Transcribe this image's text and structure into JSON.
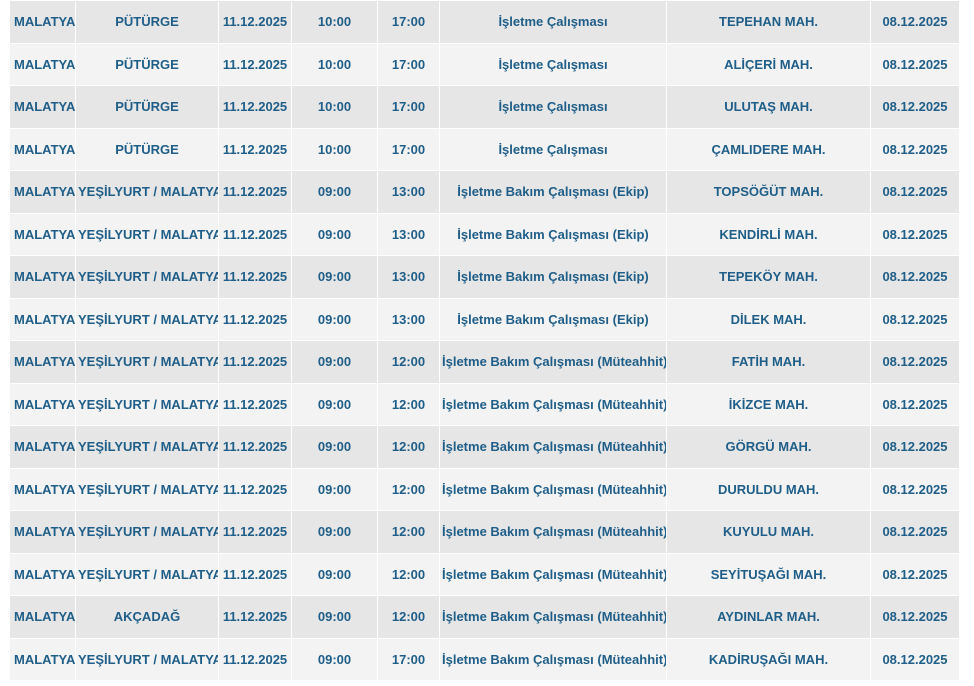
{
  "rows": [
    {
      "province": "MALATYA",
      "district": "PÜTÜRGE",
      "date": "11.12.2025",
      "start": "10:00",
      "end": "17:00",
      "type": "İşletme Çalışması",
      "neighborhood": "TEPEHAN MAH.",
      "announced": "08.12.2025"
    },
    {
      "province": "MALATYA",
      "district": "PÜTÜRGE",
      "date": "11.12.2025",
      "start": "10:00",
      "end": "17:00",
      "type": "İşletme Çalışması",
      "neighborhood": "ALİÇERİ MAH.",
      "announced": "08.12.2025"
    },
    {
      "province": "MALATYA",
      "district": "PÜTÜRGE",
      "date": "11.12.2025",
      "start": "10:00",
      "end": "17:00",
      "type": "İşletme Çalışması",
      "neighborhood": "ULUTAŞ MAH.",
      "announced": "08.12.2025"
    },
    {
      "province": "MALATYA",
      "district": "PÜTÜRGE",
      "date": "11.12.2025",
      "start": "10:00",
      "end": "17:00",
      "type": "İşletme Çalışması",
      "neighborhood": "ÇAMLIDERE MAH.",
      "announced": "08.12.2025"
    },
    {
      "province": "MALATYA",
      "district": "YEŞİLYURT / MALATYA",
      "date": "11.12.2025",
      "start": "09:00",
      "end": "13:00",
      "type": "İşletme Bakım Çalışması (Ekip)",
      "neighborhood": "TOPSÖĞÜT MAH.",
      "announced": "08.12.2025"
    },
    {
      "province": "MALATYA",
      "district": "YEŞİLYURT / MALATYA",
      "date": "11.12.2025",
      "start": "09:00",
      "end": "13:00",
      "type": "İşletme Bakım Çalışması (Ekip)",
      "neighborhood": "KENDİRLİ MAH.",
      "announced": "08.12.2025"
    },
    {
      "province": "MALATYA",
      "district": "YEŞİLYURT / MALATYA",
      "date": "11.12.2025",
      "start": "09:00",
      "end": "13:00",
      "type": "İşletme Bakım Çalışması (Ekip)",
      "neighborhood": "TEPEKÖY MAH.",
      "announced": "08.12.2025"
    },
    {
      "province": "MALATYA",
      "district": "YEŞİLYURT / MALATYA",
      "date": "11.12.2025",
      "start": "09:00",
      "end": "13:00",
      "type": "İşletme Bakım Çalışması (Ekip)",
      "neighborhood": "DİLEK MAH.",
      "announced": "08.12.2025"
    },
    {
      "province": "MALATYA",
      "district": "YEŞİLYURT / MALATYA",
      "date": "11.12.2025",
      "start": "09:00",
      "end": "12:00",
      "type": "İşletme Bakım Çalışması (Müteahhit)",
      "neighborhood": "FATİH MAH.",
      "announced": "08.12.2025"
    },
    {
      "province": "MALATYA",
      "district": "YEŞİLYURT / MALATYA",
      "date": "11.12.2025",
      "start": "09:00",
      "end": "12:00",
      "type": "İşletme Bakım Çalışması (Müteahhit)",
      "neighborhood": "İKİZCE MAH.",
      "announced": "08.12.2025"
    },
    {
      "province": "MALATYA",
      "district": "YEŞİLYURT / MALATYA",
      "date": "11.12.2025",
      "start": "09:00",
      "end": "12:00",
      "type": "İşletme Bakım Çalışması (Müteahhit)",
      "neighborhood": "GÖRGÜ MAH.",
      "announced": "08.12.2025"
    },
    {
      "province": "MALATYA",
      "district": "YEŞİLYURT / MALATYA",
      "date": "11.12.2025",
      "start": "09:00",
      "end": "12:00",
      "type": "İşletme Bakım Çalışması (Müteahhit)",
      "neighborhood": "DURULDU MAH.",
      "announced": "08.12.2025"
    },
    {
      "province": "MALATYA",
      "district": "YEŞİLYURT / MALATYA",
      "date": "11.12.2025",
      "start": "09:00",
      "end": "12:00",
      "type": "İşletme Bakım Çalışması (Müteahhit)",
      "neighborhood": "KUYULU MAH.",
      "announced": "08.12.2025"
    },
    {
      "province": "MALATYA",
      "district": "YEŞİLYURT / MALATYA",
      "date": "11.12.2025",
      "start": "09:00",
      "end": "12:00",
      "type": "İşletme Bakım Çalışması (Müteahhit)",
      "neighborhood": "SEYİTUŞAĞI MAH.",
      "announced": "08.12.2025"
    },
    {
      "province": "MALATYA",
      "district": "AKÇADAĞ",
      "date": "11.12.2025",
      "start": "09:00",
      "end": "12:00",
      "type": "İşletme Bakım Çalışması (Müteahhit)",
      "neighborhood": "AYDINLAR MAH.",
      "announced": "08.12.2025"
    },
    {
      "province": "MALATYA",
      "district": "YEŞİLYURT / MALATYA",
      "date": "11.12.2025",
      "start": "09:00",
      "end": "17:00",
      "type": "İşletme Bakım Çalışması (Müteahhit)",
      "neighborhood": "KADİRUŞAĞI MAH.",
      "announced": "08.12.2025"
    }
  ],
  "colors": {
    "text": "#1f5e88",
    "row_odd": "#e6e6e6",
    "row_even": "#f3f3f3"
  }
}
